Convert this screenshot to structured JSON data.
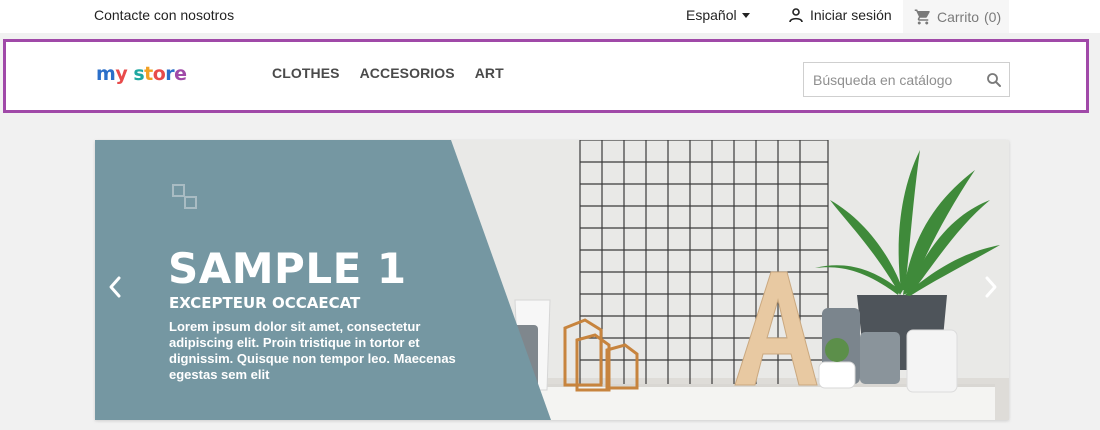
{
  "topbar": {
    "contact_label": "Contacte con nosotros",
    "language_label": "Español",
    "signin_label": "Iniciar sesión",
    "cart_label": "Carrito",
    "cart_count": "(0)"
  },
  "header": {
    "logo": {
      "word1": "my",
      "word2": "store"
    },
    "nav": [
      "CLOTHES",
      "ACCESORIOS",
      "ART"
    ],
    "search": {
      "placeholder": "Búsqueda en catálogo",
      "value": ""
    }
  },
  "slider": {
    "title": "SAMPLE 1",
    "subtitle": "EXCEPTEUR OCCAECAT",
    "text": "Lorem ipsum dolor sit amet, consectetur adipiscing elit. Proin tristique in tortor et dignissim. Quisque non tempor leo. Maecenas egestas sem elit"
  },
  "icons": {
    "user": "user-icon",
    "cart": "cart-icon",
    "search": "search-icon",
    "caret": "caret-down-icon",
    "prev": "chevron-left-icon",
    "next": "chevron-right-icon"
  },
  "colors": {
    "accent_border": "#a049a8",
    "slide_panel": "#7597a2",
    "logo_m": "#2b6fc9",
    "logo_y": "#e84b4b",
    "logo_store": "#1ea7a0"
  }
}
